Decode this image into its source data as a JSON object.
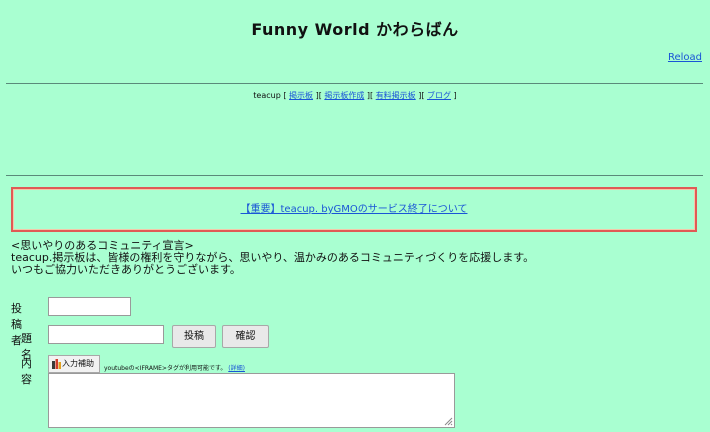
{
  "header": {
    "title": "Funny  World  かわらばん",
    "reload": "Reload"
  },
  "nav": {
    "prefix": "teacup",
    "items": [
      "掲示板",
      "掲示板作成",
      "有料掲示板",
      "ブログ"
    ]
  },
  "notice": {
    "link": "【重要】teacup. byGMOのサービス終了について"
  },
  "declaration": {
    "line1": "<思いやりのあるコミュニティ宣言>",
    "line2": "teacup.掲示板は、皆様の権利を守りながら、思いやり、温かみのあるコミュニティづくりを応援します。",
    "line3": "いつもご協力いただきありがとうございます。"
  },
  "form": {
    "poster_label": "投稿者",
    "poster_value": "",
    "subject_label": "題名",
    "subject_value": "",
    "post_button": "投稿",
    "confirm_button": "確認",
    "content_label": "内容",
    "helper_button": "入力補助",
    "note_text": "youtubeの<IFRAME>タグが利用可能です。",
    "note_link": "(詳細)",
    "content_value": ""
  },
  "colors": {
    "background": "#a9ffd1",
    "link": "#1a55d6",
    "notice_border": "#e05a55"
  }
}
